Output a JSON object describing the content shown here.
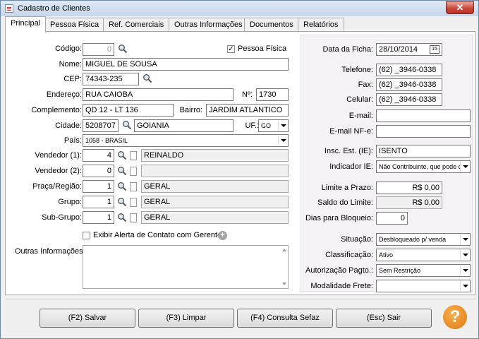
{
  "window": {
    "title": "Cadastro de Clientes",
    "close_glyph": "✕"
  },
  "tabs": [
    "Principal",
    "Pessoa Física",
    "Ref. Comerciais",
    "Outras Informações",
    "Documentos",
    "Relatórios"
  ],
  "form": {
    "codigo_label": "Código:",
    "codigo_value": "0",
    "pessoa_fisica_label": "Pessoa Física",
    "pessoa_fisica_checked": "✓",
    "nome_label": "Nome:",
    "nome_value": "MIGUEL DE SOUSA",
    "cep_label": "CEP:",
    "cep_value": "74343-235",
    "endereco_label": "Endereço:",
    "endereco_value": "RUA CAIOBA",
    "numero_label": "Nº:",
    "numero_value": "1730",
    "complemento_label": "Complemento:",
    "complemento_value": "QD 12 - LT 136",
    "bairro_label": "Bairro:",
    "bairro_value": "JARDIM ATLANTICO",
    "cidade_label": "Cidade:",
    "cidade_code": "5208707",
    "cidade_name": "GOIANIA",
    "uf_label": "UF.:",
    "uf_value": "GO",
    "pais_label": "País:",
    "pais_value": "1058 - BRASIL",
    "vendedor1_label": "Vendedor (1):",
    "vendedor1_code": "4",
    "vendedor1_name": "REINALDO",
    "vendedor2_label": "Vendedor (2):",
    "vendedor2_code": "0",
    "vendedor2_name": "",
    "praca_label": "Praça/Região:",
    "praca_code": "1",
    "praca_name": "GERAL",
    "grupo_label": "Grupo:",
    "grupo_code": "1",
    "grupo_name": "GERAL",
    "subgrupo_label": "Sub-Grupo:",
    "subgrupo_code": "1",
    "subgrupo_name": "GERAL",
    "alerta_label": "Exibir Alerta de Contato com Gerente",
    "outras_label": "Outras Informações:"
  },
  "right": {
    "data_ficha_label": "Data da Ficha:",
    "data_ficha_value": "28/10/2014",
    "cal_glyph": "15",
    "telefone_label": "Telefone:",
    "telefone_value": "(62) _3946-0338",
    "fax_label": "Fax:",
    "fax_value": "(62) _3946-0338",
    "celular_label": "Celular:",
    "celular_value": "(62) _3946-0338",
    "email_label": "E-mail:",
    "email_value": "",
    "email_nfe_label": "E-mail NF-e:",
    "email_nfe_value": "",
    "insc_label": "Insc. Est. (IE):",
    "insc_value": "ISENTO",
    "indicador_label": "Indicador IE:",
    "indicador_value": "Não Contribuinte, que pode ou",
    "limite_label": "Limite a Prazo:",
    "limite_value": "R$ 0,00",
    "saldo_label": "Saldo do Limite:",
    "saldo_value": "R$ 0,00",
    "dias_label": "Dias para Bloqueio:",
    "dias_value": "0",
    "situacao_label": "Situação:",
    "situacao_value": "Desbloqueado p/ venda",
    "classificacao_label": "Classificação:",
    "classificacao_value": "Ativo",
    "autorizacao_label": "Autorização Pagto.:",
    "autorizacao_value": "Sem Restrição",
    "modalidade_label": "Modalidade Frete:",
    "modalidade_value": ""
  },
  "buttons": {
    "salvar": "(F2) Salvar",
    "limpar": "(F3) Limpar",
    "consulta": "(F4) Consulta Sefaz",
    "sair": "(Esc) Sair",
    "help": "?"
  }
}
